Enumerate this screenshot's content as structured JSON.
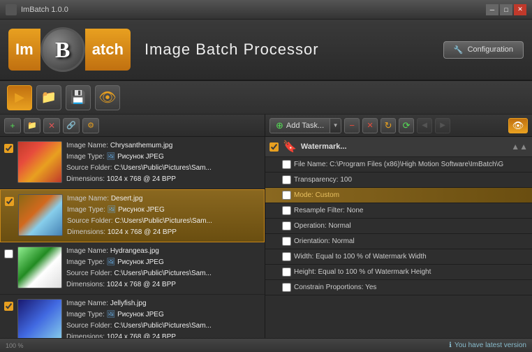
{
  "window": {
    "title": "ImBatch 1.0.0"
  },
  "header": {
    "logo_im": "Im",
    "logo_b": "B",
    "logo_atch": "atch",
    "app_title": "Image Batch Processor",
    "config_button": "Configuration"
  },
  "toolbar": {
    "buttons": [
      {
        "icon": "▶",
        "label": "run",
        "active": true
      },
      {
        "icon": "📁",
        "label": "folder",
        "active": false
      },
      {
        "icon": "💾",
        "label": "save",
        "active": false
      },
      {
        "icon": "👁",
        "label": "preview",
        "active": false
      }
    ]
  },
  "left_toolbar": {
    "buttons": [
      {
        "icon": "+",
        "color": "green",
        "label": "add-image"
      },
      {
        "icon": "📁",
        "color": "orange",
        "label": "add-folder"
      },
      {
        "icon": "✕",
        "color": "red",
        "label": "remove-image"
      },
      {
        "icon": "↑",
        "color": "blue",
        "label": "move-up"
      },
      {
        "icon": "↓",
        "color": "orange",
        "label": "move-down"
      }
    ]
  },
  "images": [
    {
      "name": "Chrysanthemum.jpg",
      "type": "Рисунок JPEG",
      "source": "C:\\Users\\Public\\Pictures\\Sam...",
      "dimensions": "1024 x 768 @ 24 BPP",
      "checked": true,
      "thumb_class": "thumb-chrysanthemum",
      "selected": false
    },
    {
      "name": "Desert.jpg",
      "type": "Рисунок JPEG",
      "source": "C:\\Users\\Public\\Pictures\\Sam...",
      "dimensions": "1024 x 768 @ 24 BPP",
      "checked": true,
      "thumb_class": "thumb-desert",
      "selected": true
    },
    {
      "name": "Hydrangeas.jpg",
      "type": "Рисунок JPEG",
      "source": "C:\\Users\\Public\\Pictures\\Sam...",
      "dimensions": "1024 x 768 @ 24 BPP",
      "checked": false,
      "thumb_class": "thumb-hydrangeas",
      "selected": false
    },
    {
      "name": "Jellyfish.jpg",
      "type": "Рисунок JPEG",
      "source": "C:\\Users\\Public\\Pictures\\Sam...",
      "dimensions": "1024 x 768 @ 24 BPP",
      "checked": true,
      "thumb_class": "thumb-jellyfish",
      "selected": false
    }
  ],
  "right_toolbar": {
    "add_task": "Add Task...",
    "buttons": [
      {
        "icon": "−",
        "label": "remove-task",
        "color": "red-btn"
      },
      {
        "icon": "✕",
        "label": "delete-task",
        "color": "red-btn"
      },
      {
        "icon": "↻",
        "label": "refresh",
        "color": "orange-btn"
      },
      {
        "icon": "⟳",
        "label": "reload",
        "color": "green-btn"
      },
      {
        "icon": "👁",
        "label": "eye",
        "color": "eye-btn"
      }
    ]
  },
  "tasks": {
    "header": {
      "label": "Watermark...",
      "icon": "🔖"
    },
    "items": [
      {
        "text": "File Name: C:\\Program Files (x86)\\High Motion Software\\ImBatch\\G",
        "checked": false,
        "highlighted": false
      },
      {
        "text": "Transparency: 100",
        "checked": false,
        "highlighted": false
      },
      {
        "text": "Mode: Custom",
        "checked": false,
        "highlighted": true
      },
      {
        "text": "Resample Filter: None",
        "checked": false,
        "highlighted": false
      },
      {
        "text": "Operation: Normal",
        "checked": false,
        "highlighted": false
      },
      {
        "text": "Orientation: Normal",
        "checked": false,
        "highlighted": false
      },
      {
        "text": "Width: Equal to 100 % of Watermark Width",
        "checked": false,
        "highlighted": false
      },
      {
        "text": "Height: Equal to 100 % of Watermark Height",
        "checked": false,
        "highlighted": false
      },
      {
        "text": "Constrain Proportions: Yes",
        "checked": false,
        "highlighted": false
      }
    ]
  },
  "status": {
    "message": "You have latest version",
    "zoom": "100 %"
  }
}
